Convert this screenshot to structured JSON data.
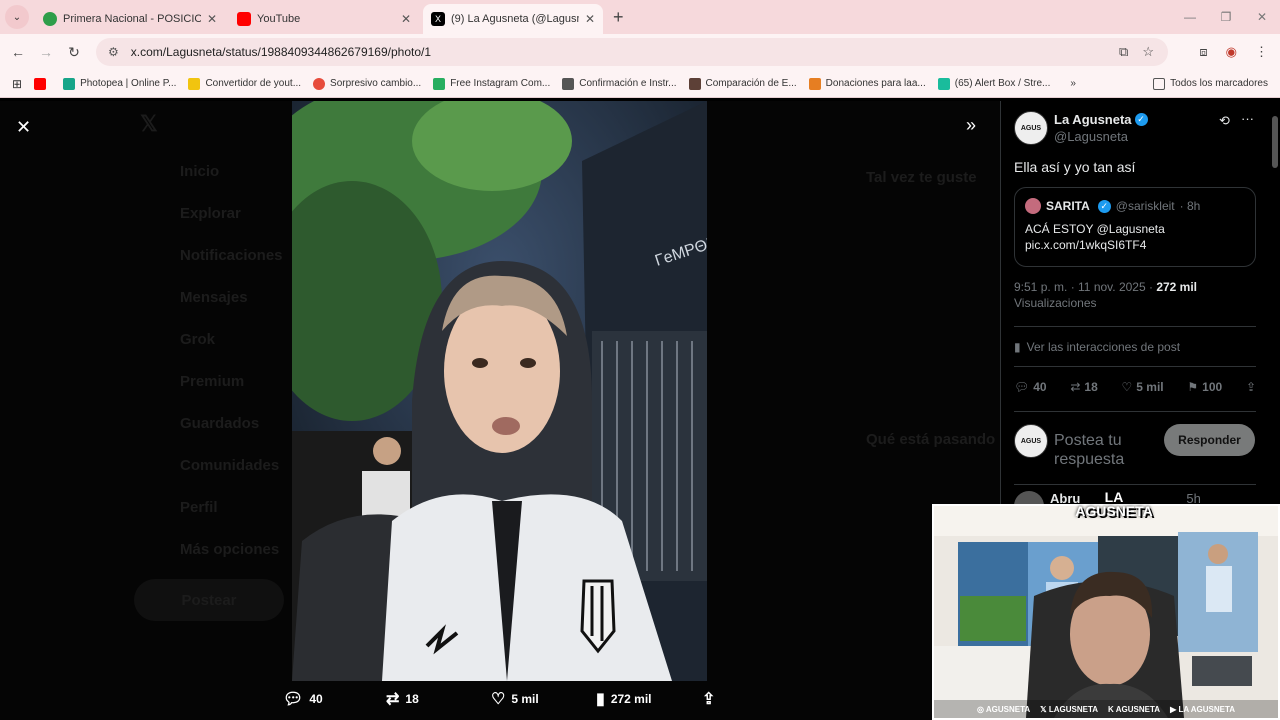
{
  "browser": {
    "tabs": [
      {
        "title": "Primera Nacional - POSICIONES",
        "color": "#2e9e4a"
      },
      {
        "title": "YouTube",
        "color": "#ff0000"
      },
      {
        "title": "(9) La Agusneta (@Lagusneta) / X",
        "color": "#000000"
      }
    ],
    "url": "x.com/Lagusneta/status/1988409344862679169/photo/1",
    "bookmarks": [
      {
        "label": "",
        "color": "#ff0000"
      },
      {
        "label": "Photopea | Online P...",
        "color": "#17a589"
      },
      {
        "label": "Convertidor de yout...",
        "color": "#f1c40f"
      },
      {
        "label": "Sorpresivo cambio...",
        "color": "#e74c3c"
      },
      {
        "label": "Free Instagram Com...",
        "color": "#27ae60"
      },
      {
        "label": "Confirmación e Instr...",
        "color": "#555555"
      },
      {
        "label": "Comparación de E...",
        "color": "#5d4037"
      },
      {
        "label": "Donaciones para laa...",
        "color": "#e67e22"
      },
      {
        "label": "(65) Alert Box / Stre...",
        "color": "#1abc9c"
      }
    ],
    "all_bookmarks": "Todos los marcadores"
  },
  "background_sidebar": [
    "Inicio",
    "Explorar",
    "Notificaciones",
    "Mensajes",
    "Grok",
    "Premium",
    "Guardados",
    "Comunidades",
    "Perfil",
    "Más opciones"
  ],
  "background_post_button": "Postear",
  "background_right": {
    "title": "Tal vez te guste",
    "trending": "Qué está pasando"
  },
  "photo_actions": {
    "replies": "40",
    "reposts": "18",
    "likes": "5 mil",
    "views": "272 mil"
  },
  "post": {
    "author_name": "La Agusneta",
    "author_handle": "@Lagusneta",
    "text": "Ella así y yo tan así",
    "quote": {
      "name": "SARITA",
      "handle": "@sariskleit",
      "time": "· 8h",
      "line1": "ACÁ ESTOY @Lagusneta",
      "line2": "pic.x.com/1wkqSI6TF4"
    },
    "time": "9:51 p. m. · 11 nov. 2025 ·",
    "views_count": "272 mil",
    "views_label": "Visualizaciones",
    "interactions_link": "Ver las interacciones de post",
    "stats": {
      "replies": "40",
      "reposts": "18",
      "likes": "5 mil",
      "bookmarks": "100"
    },
    "reply_placeholder": "Postea tu respuesta",
    "reply_button": "Responder",
    "next_reply_name": "Abru",
    "next_reply_time": "5h"
  },
  "webcam": {
    "logo_line1": "LA",
    "logo_line2": "AGUSNETA",
    "socials": [
      "AGUSNETA",
      "LAGUSNETA",
      "AGUSNETA",
      "LA AGUSNETA"
    ]
  }
}
